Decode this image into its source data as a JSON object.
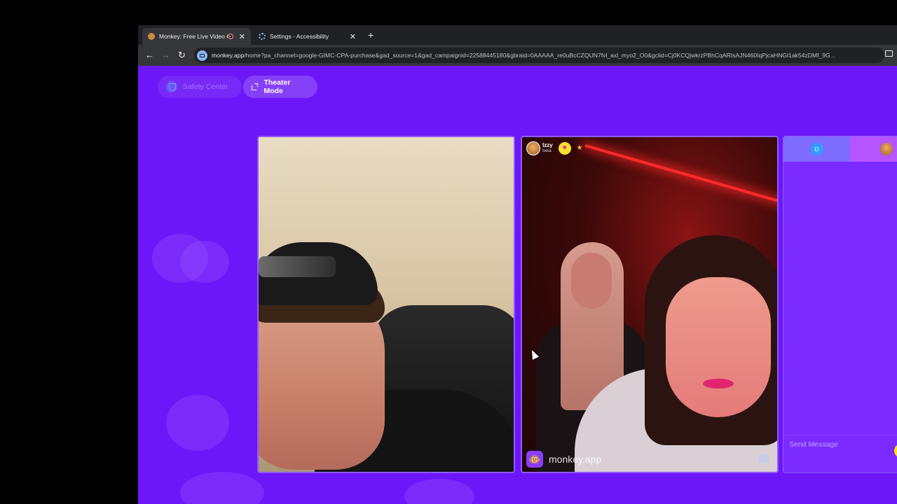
{
  "browser": {
    "tabs": [
      {
        "title": "Monkey: Free Live Video Ch",
        "active": true,
        "recording": true
      },
      {
        "title": "Settings - Accessibility",
        "active": false
      }
    ],
    "new_tab_label": "+",
    "nav": {
      "back": "←",
      "forward": "→",
      "reload": "↻"
    },
    "url_host": "monkey.app",
    "url_path": "/home?pa_channel=google-GIMC-CPA-purchase&gad_source=1&gad_campaignid=22588445180&gbraid=0AAAAA_re0uBcCZQUN7fvl_axl_myo2_O0&gclid=Cj0KCQjwkrzPBhCqARIsAJN460IqPjcaHNGl1ak54zDMf_9G..."
  },
  "page": {
    "safety_center_label": "Safety Center",
    "theater_mode_label": "Theater Mode",
    "remote_user": {
      "name": "Izzy",
      "location": "Iowa"
    },
    "watermark_text": "monkey.app",
    "chat": {
      "user_initial": "D",
      "message_placeholder": "Send Message"
    },
    "colors": {
      "page_bg": "#6c17f7",
      "accent_yellow": "#ffe600"
    }
  }
}
